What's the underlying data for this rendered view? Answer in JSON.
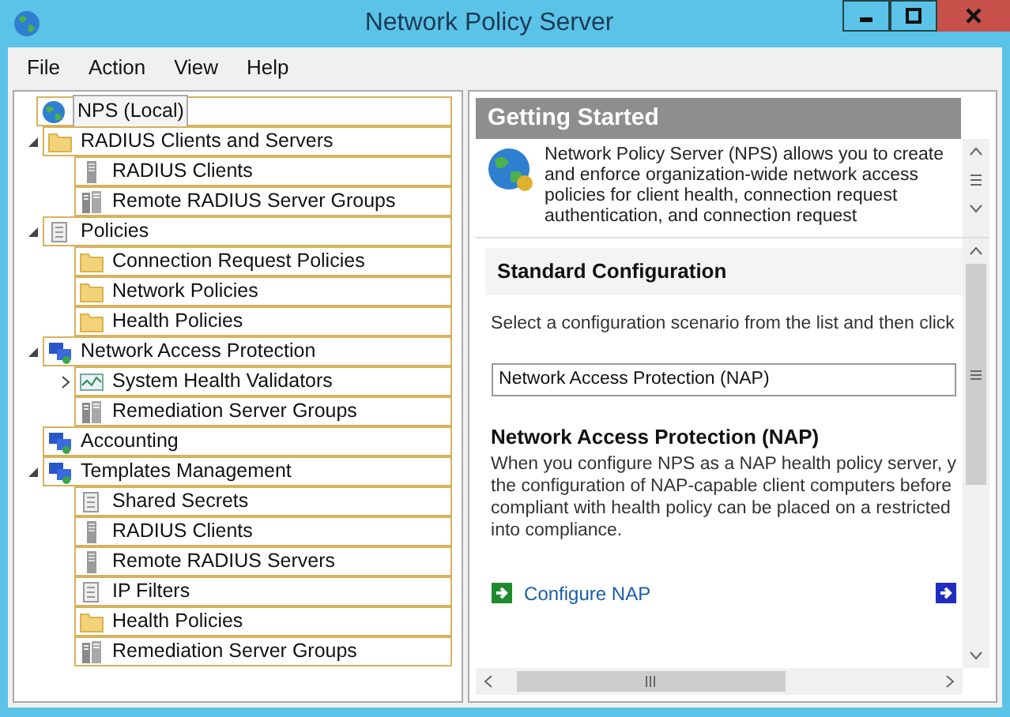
{
  "window": {
    "title": "Network Policy Server"
  },
  "menu": [
    "File",
    "Action",
    "View",
    "Help"
  ],
  "tree": [
    {
      "label": "NPS (Local)",
      "kind": "globe",
      "children": [
        {
          "label": "RADIUS Clients and Servers",
          "kind": "folder",
          "expanded": true,
          "children": [
            {
              "label": "RADIUS Clients",
              "kind": "server"
            },
            {
              "label": "Remote RADIUS Server Groups",
              "kind": "server-group"
            }
          ]
        },
        {
          "label": "Policies",
          "kind": "document",
          "expanded": true,
          "children": [
            {
              "label": "Connection Request Policies",
              "kind": "folder"
            },
            {
              "label": "Network Policies",
              "kind": "folder"
            },
            {
              "label": "Health Policies",
              "kind": "folder"
            }
          ]
        },
        {
          "label": "Network Access Protection",
          "kind": "computer",
          "expanded": true,
          "children": [
            {
              "label": "System Health Validators",
              "kind": "chart",
              "expanded": false
            },
            {
              "label": "Remediation Server Groups",
              "kind": "server-group"
            }
          ]
        },
        {
          "label": "Accounting",
          "kind": "computer"
        },
        {
          "label": "Templates Management",
          "kind": "computer",
          "expanded": true,
          "children": [
            {
              "label": "Shared Secrets",
              "kind": "document"
            },
            {
              "label": "RADIUS Clients",
              "kind": "server"
            },
            {
              "label": "Remote RADIUS Servers",
              "kind": "server"
            },
            {
              "label": "IP Filters",
              "kind": "document"
            },
            {
              "label": "Health Policies",
              "kind": "folder"
            },
            {
              "label": "Remediation Server Groups",
              "kind": "server-group"
            }
          ]
        }
      ]
    }
  ],
  "getting_started": {
    "title": "Getting Started",
    "intro": [
      "Network Policy Server (NPS) allows you to create",
      "and enforce organization-wide network access",
      "policies for client health, connection request",
      "authentication, and connection request"
    ]
  },
  "standard_configuration": {
    "title": "Standard Configuration",
    "instruction": "Select a configuration scenario from the list and then click",
    "scenario": "Network Access Protection (NAP)",
    "section_title": "Network Access Protection (NAP)",
    "description": [
      "When you configure NPS as a NAP health policy server, y",
      "the configuration of NAP-capable client computers before",
      "compliant with health policy can be placed on a restricted",
      "into compliance."
    ],
    "link": "Configure NAP"
  }
}
